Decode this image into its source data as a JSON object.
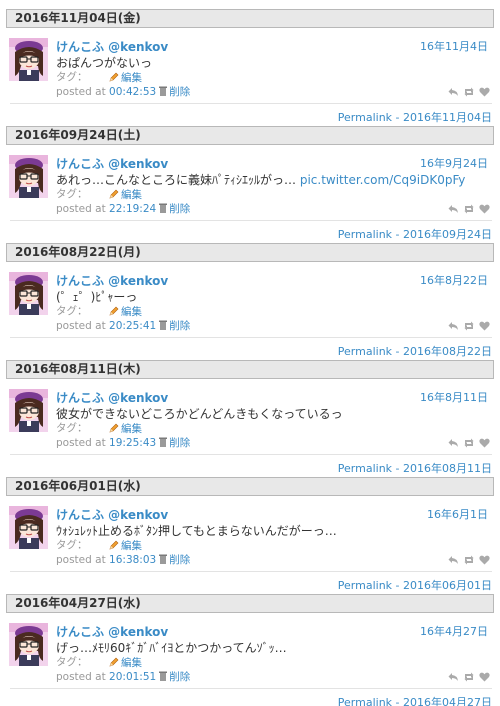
{
  "colors": {
    "link": "#3a8bc6",
    "header_bg": "#e8e8e8",
    "muted": "#999999"
  },
  "labels": {
    "tag_label": "タグ：",
    "edit": "編集",
    "posted_at": "posted at",
    "delete": "削除"
  },
  "days": [
    {
      "header": "2016年11月04日(金)",
      "name": "けんこふ @kenkov",
      "date": "16年11月4日",
      "text": "おぱんつがないっ",
      "link": "",
      "time": "00:42:53",
      "permalink": "Permalink - 2016年11月04日"
    },
    {
      "header": "2016年09月24日(土)",
      "name": "けんこふ @kenkov",
      "date": "16年9月24日",
      "text": "あれっ…こんなところに義妹ﾊﾟﾃｨｼｴｯﾙがっ…",
      "link": "pic.twitter.com/Cq9iDK0pFy",
      "time": "22:19:24",
      "permalink": "Permalink - 2016年09月24日"
    },
    {
      "header": "2016年08月22日(月)",
      "name": "けんこふ @kenkov",
      "date": "16年8月22日",
      "text": "(゜ｪ゜)ﾋﾟｬーっ",
      "link": "",
      "time": "20:25:41",
      "permalink": "Permalink - 2016年08月22日"
    },
    {
      "header": "2016年08月11日(木)",
      "name": "けんこふ @kenkov",
      "date": "16年8月11日",
      "text": "彼女ができないどころかどんどんきもくなっているっ",
      "link": "",
      "time": "19:25:43",
      "permalink": "Permalink - 2016年08月11日"
    },
    {
      "header": "2016年06月01日(水)",
      "name": "けんこふ @kenkov",
      "date": "16年6月1日",
      "text": "ｳｫｼｭﾚｯﾄ止めるﾎﾞﾀﾝ押してもとまらないんだがーっ…",
      "link": "",
      "time": "16:38:03",
      "permalink": "Permalink - 2016年06月01日"
    },
    {
      "header": "2016年04月27日(水)",
      "name": "けんこふ @kenkov",
      "date": "16年4月27日",
      "text": "げっ…ﾒﾓﾘ60ｷﾞｶﾞﾊﾞｲﾖとかつかってんｿﾞｯ…",
      "link": "",
      "time": "20:01:51",
      "permalink": "Permalink - 2016年04月27日"
    }
  ]
}
